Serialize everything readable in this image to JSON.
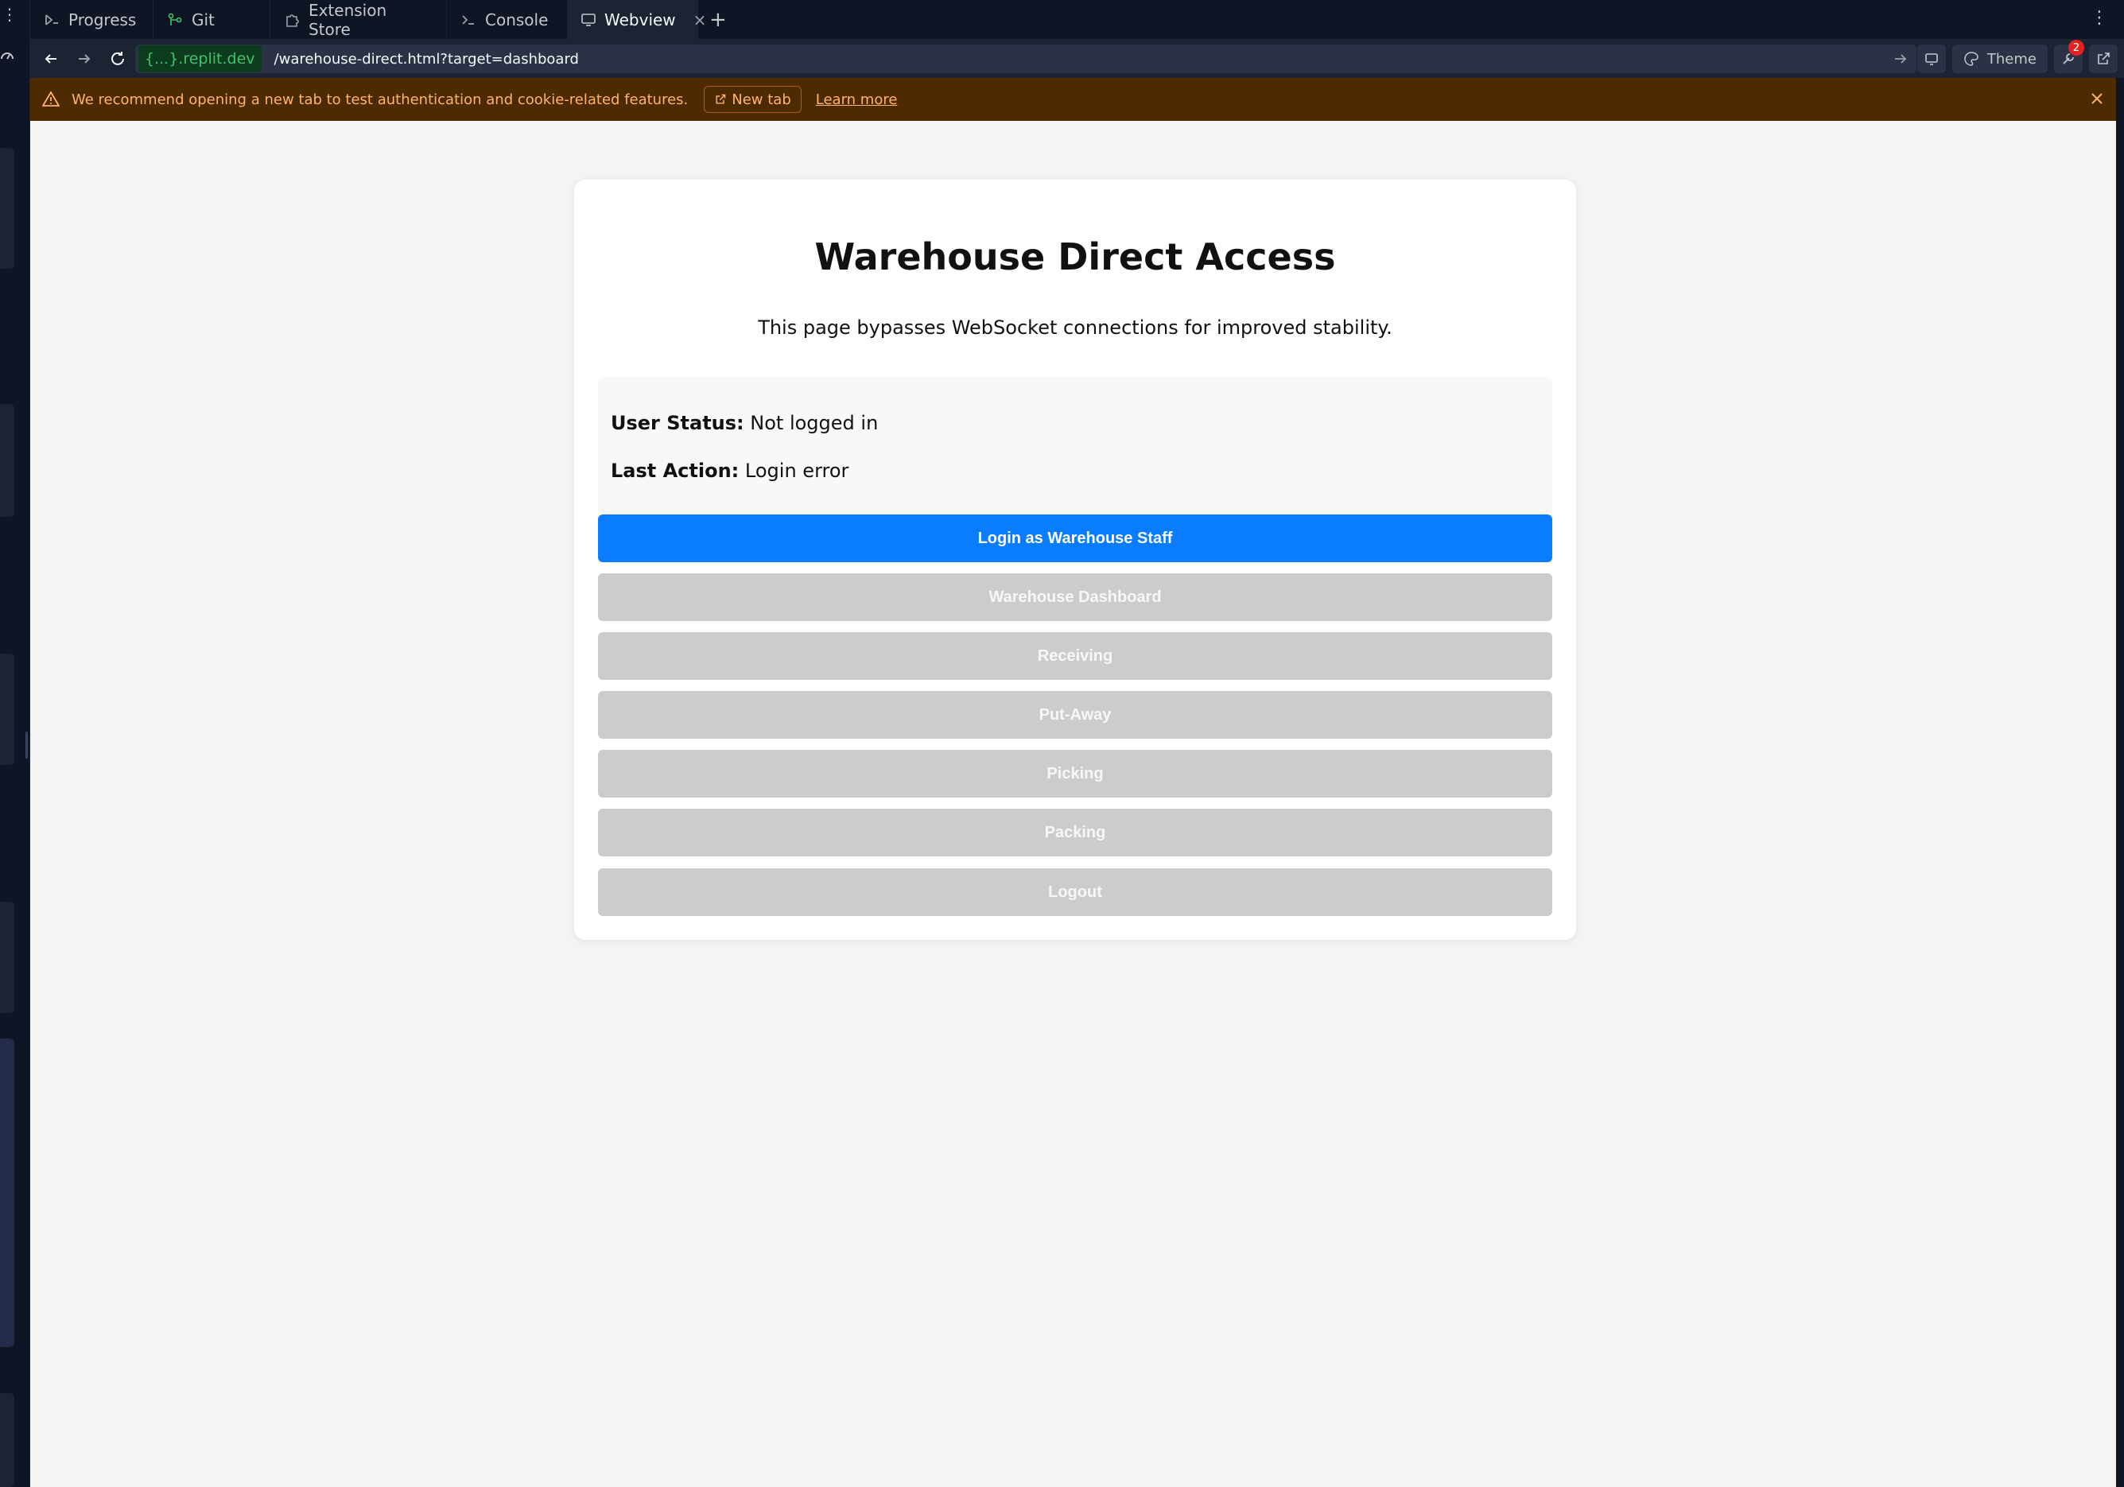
{
  "tabs": [
    {
      "label": "Progress",
      "icon": "progress-icon",
      "active": false
    },
    {
      "label": "Git",
      "icon": "git-icon",
      "active": false
    },
    {
      "label": "Extension Store",
      "icon": "puzzle-icon",
      "active": false
    },
    {
      "label": "Console",
      "icon": "terminal-icon",
      "active": false
    },
    {
      "label": "Webview",
      "icon": "monitor-icon",
      "active": true
    }
  ],
  "address": {
    "domain": "{...}.replit.dev",
    "path": "/warehouse-direct.html?target=dashboard"
  },
  "toolbar": {
    "theme_label": "Theme",
    "notification_count": "2"
  },
  "banner": {
    "message": "We recommend opening a new tab to test authentication and cookie-related features.",
    "new_tab_label": "New tab",
    "learn_more_label": "Learn more"
  },
  "page": {
    "title": "Warehouse Direct Access",
    "subtitle": "This page bypasses WebSocket connections for improved stability.",
    "user_status_label": "User Status:",
    "user_status_value": "Not logged in",
    "last_action_label": "Last Action:",
    "last_action_value": "Login error",
    "buttons": {
      "login": "Login as Warehouse Staff",
      "dashboard": "Warehouse Dashboard",
      "receiving": "Receiving",
      "putaway": "Put-Away",
      "picking": "Picking",
      "packing": "Packing",
      "logout": "Logout"
    }
  },
  "colors": {
    "accent": "#0a7cff",
    "disabled": "#cccccc",
    "banner_bg": "#4e2a00",
    "banner_text": "#ffb36b",
    "domain_text": "#3ec46d"
  }
}
